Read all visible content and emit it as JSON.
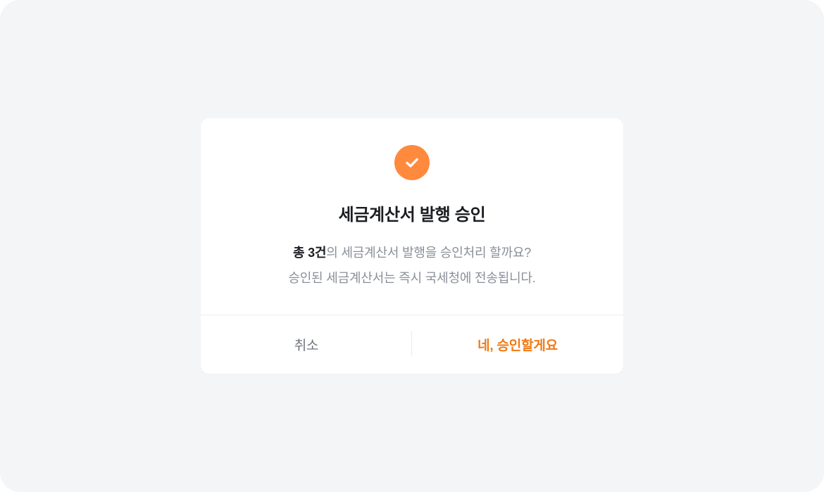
{
  "dialog": {
    "icon": "check-circle-icon",
    "title": "세금계산서 발행 승인",
    "message": {
      "count_text": "총 3건",
      "line1_rest": "의 세금계산서 발행을 승인처리 할까요?",
      "line2": "승인된 세금계산서는 즉시 국세청에 전송됩니다."
    },
    "buttons": {
      "cancel": "취소",
      "confirm": "네, 승인할게요"
    }
  },
  "colors": {
    "accent": "#ff8a3d",
    "confirm_text": "#f07a14",
    "background": "#f4f5f7",
    "card": "#ffffff"
  }
}
